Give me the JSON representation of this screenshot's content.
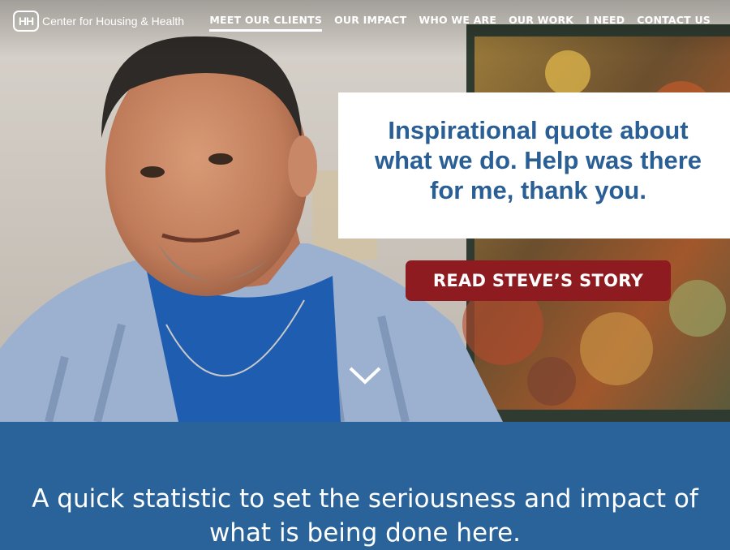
{
  "brand": {
    "mark": "HH",
    "name": "Center for Housing & Health"
  },
  "nav": {
    "items": [
      {
        "label": "MEET OUR CLIENTS",
        "active": true
      },
      {
        "label": "OUR IMPACT"
      },
      {
        "label": "WHO WE ARE"
      },
      {
        "label": "OUR WORK"
      },
      {
        "label": "I NEED"
      },
      {
        "label": "CONTACT US"
      }
    ]
  },
  "hero": {
    "quote": "Inspirational quote about what we do. Help was there for me, thank you.",
    "cta_label": "READ STEVE’S STORY",
    "scroll_icon": "chevron-down-icon"
  },
  "stats": {
    "text": "A quick statistic to set the seriousness and impact of what is being done here."
  },
  "colors": {
    "brand_blue": "#2a6399",
    "quote_blue": "#2a5f96",
    "cta_red": "#8e1b1f",
    "white": "#ffffff"
  }
}
